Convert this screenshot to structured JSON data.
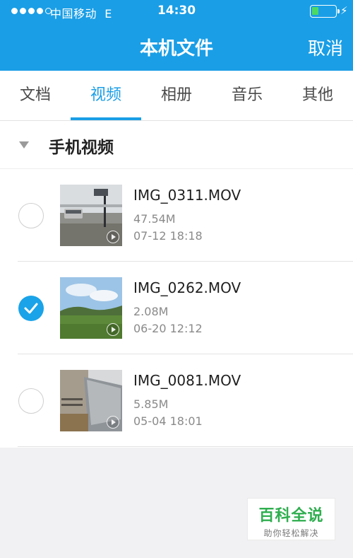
{
  "status_bar": {
    "carrier": "中国移动",
    "network": "E",
    "time": "14:30",
    "battery_level": 0.25,
    "signal_filled": 4,
    "signal_total": 5
  },
  "header": {
    "title": "本机文件",
    "cancel_label": "取消"
  },
  "tabs": [
    {
      "label": "文档",
      "active": false
    },
    {
      "label": "视频",
      "active": true
    },
    {
      "label": "相册",
      "active": false
    },
    {
      "label": "音乐",
      "active": false
    },
    {
      "label": "其他",
      "active": false
    }
  ],
  "section": {
    "title": "手机视频"
  },
  "files": [
    {
      "name": "IMG_0311.MOV",
      "size": "47.54M",
      "date": "07-12 18:18",
      "selected": false
    },
    {
      "name": "IMG_0262.MOV",
      "size": "2.08M",
      "date": "06-20 12:12",
      "selected": true
    },
    {
      "name": "IMG_0081.MOV",
      "size": "5.85M",
      "date": "05-04 18:01",
      "selected": false
    }
  ],
  "watermark": {
    "title": "百科全说",
    "subtitle": "助你轻松解决"
  },
  "colors": {
    "accent": "#1a9ee6",
    "selected": "#1aa3e8",
    "watermark_green": "#2fae4f"
  }
}
